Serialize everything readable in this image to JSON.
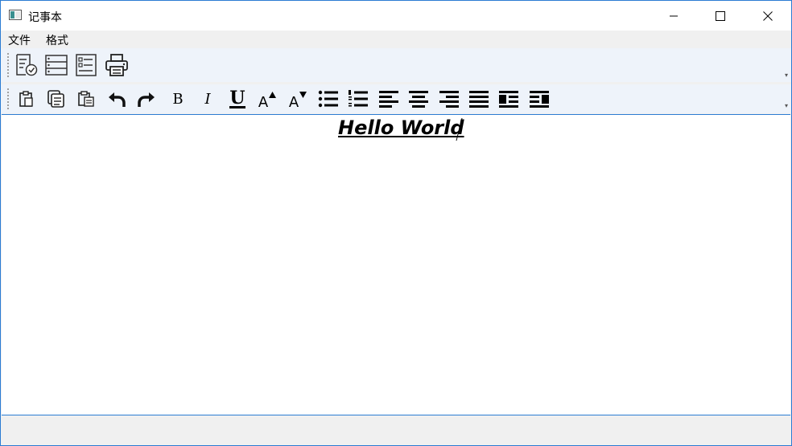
{
  "window": {
    "title": "记事本"
  },
  "menu": {
    "file": "文件",
    "format": "格式"
  },
  "toolbar_file": {
    "icons": [
      "document-check-icon",
      "list-view-icon",
      "details-view-icon",
      "printer-icon"
    ]
  },
  "toolbar_format": {
    "bold_label": "B",
    "italic_label": "I",
    "underline_label": "U",
    "grow_font_label": "A",
    "shrink_font_label": "A"
  },
  "editor": {
    "text": "Hello World"
  },
  "colors": {
    "accent": "#2b7cd3",
    "toolbar_bg": "#eef3fa",
    "chrome_bg": "#f0f0f0"
  }
}
